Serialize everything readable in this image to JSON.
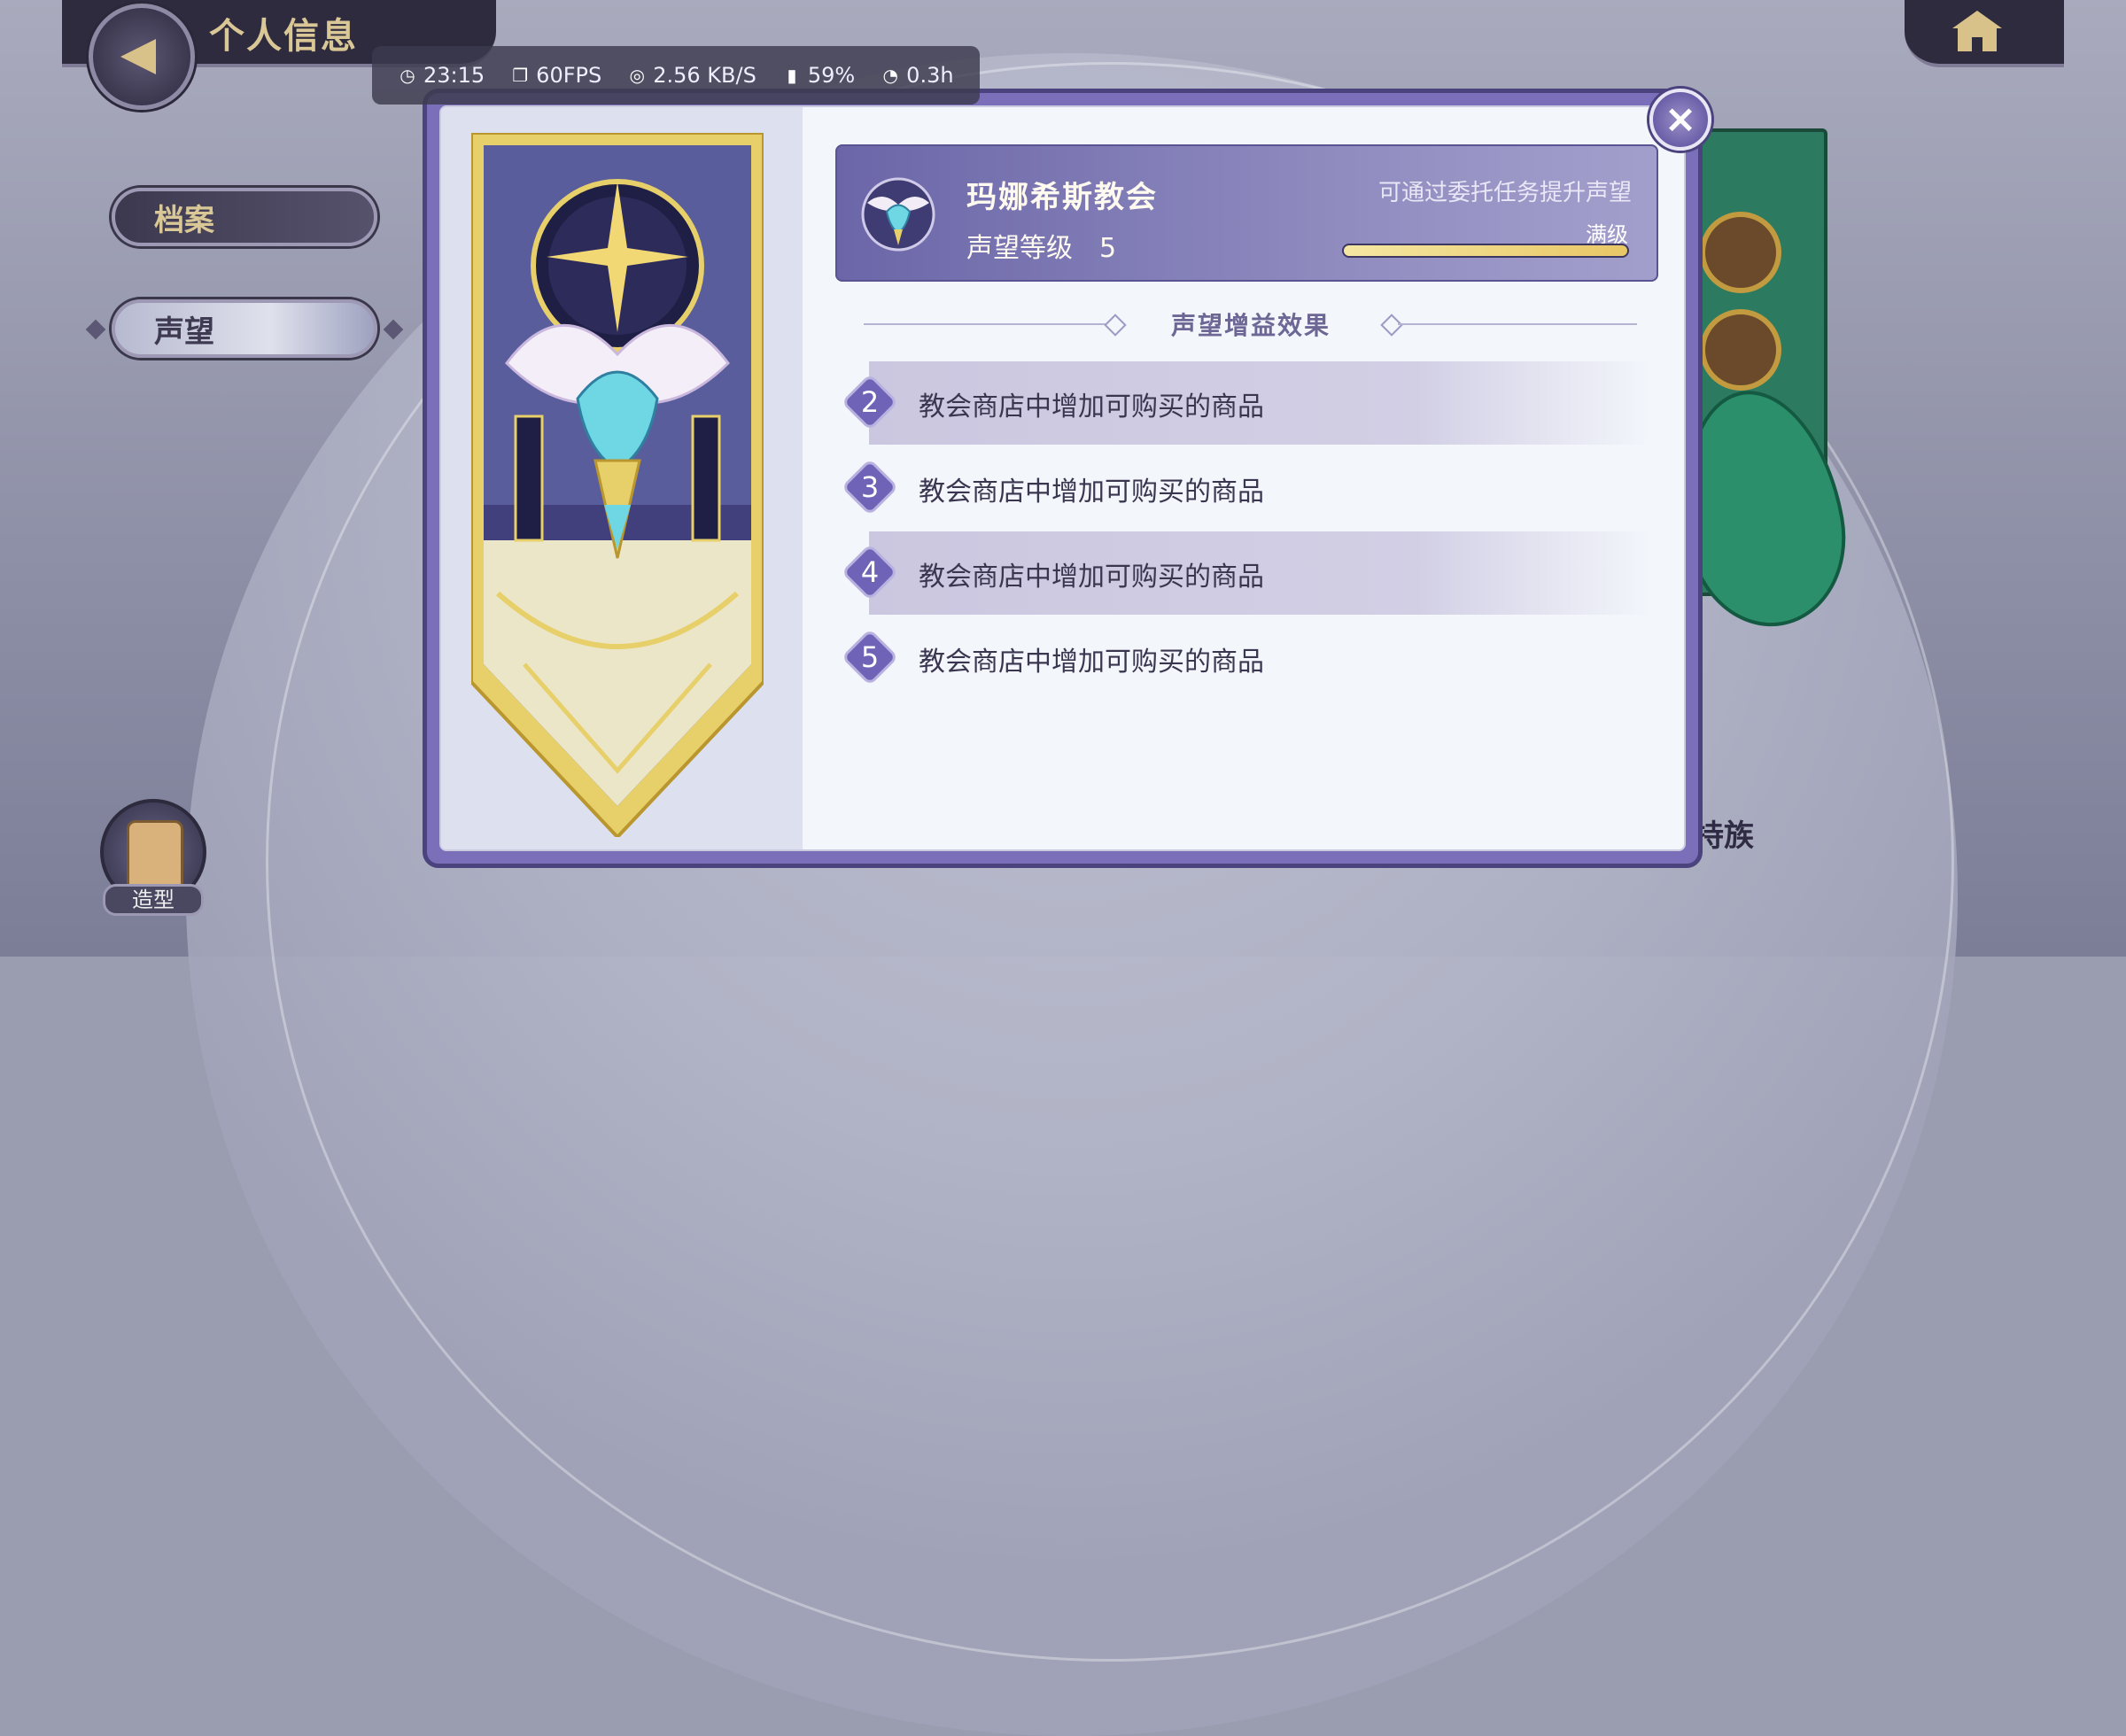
{
  "header": {
    "title": "个人信息"
  },
  "status_bar": {
    "time": "23:15",
    "fps": "60FPS",
    "network": "2.56 KB/S",
    "battery": "59%",
    "duration": "0.3h"
  },
  "menu": {
    "items": [
      {
        "label": "档案",
        "active": false
      },
      {
        "label": "声望",
        "active": true
      }
    ]
  },
  "outfit": {
    "label": "造型"
  },
  "background_partial_text": "持族",
  "reputation": {
    "faction": "玛娜希斯教会",
    "level_label": "声望等级",
    "level": "5",
    "hint": "可通过委托任务提升声望",
    "max_label": "满级",
    "progress": 1.0
  },
  "effects_section": {
    "title": "声望增益效果",
    "items": [
      {
        "level": "2",
        "text": "教会商店中增加可购买的商品"
      },
      {
        "level": "3",
        "text": "教会商店中增加可购买的商品"
      },
      {
        "level": "4",
        "text": "教会商店中增加可购买的商品"
      },
      {
        "level": "5",
        "text": "教会商店中增加可购买的商品"
      }
    ]
  },
  "colors": {
    "dialog_frame": "#7a6fb8",
    "header_card": "#6b66a8",
    "badge": "#6f63b8",
    "gold": "#d9c796"
  }
}
